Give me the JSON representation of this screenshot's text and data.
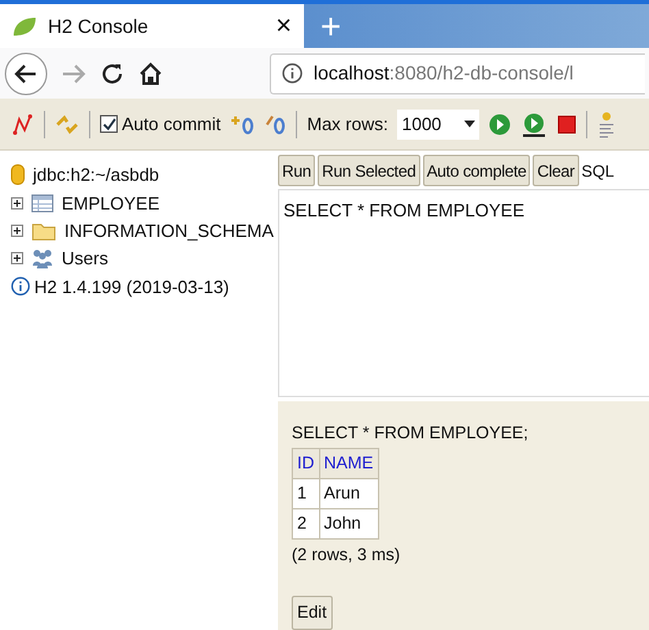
{
  "browser": {
    "tab": {
      "title": "H2 Console",
      "close": "×"
    },
    "new_tab": "+",
    "url": {
      "host": "localhost",
      "rest": ":8080/h2-db-console/l"
    }
  },
  "toolbar": {
    "auto_commit": {
      "label": "Auto commit",
      "checked": true
    },
    "max_rows": {
      "label": "Max rows:",
      "value": "1000"
    }
  },
  "tree": {
    "connection": "jdbc:h2:~/asbdb",
    "items": [
      {
        "kind": "table",
        "label": "EMPLOYEE",
        "expanded": false
      },
      {
        "kind": "folder",
        "label": "INFORMATION_SCHEMA",
        "expanded": false
      },
      {
        "kind": "users",
        "label": "Users",
        "expanded": false
      }
    ],
    "version": "H2 1.4.199 (2019-03-13)"
  },
  "query_buttons": [
    "Run",
    "Run Selected",
    "Auto complete",
    "Clear"
  ],
  "query_label": "SQL",
  "editor": {
    "value": "SELECT * FROM EMPLOYEE"
  },
  "result": {
    "statement": "SELECT * FROM EMPLOYEE;",
    "columns": [
      "ID",
      "NAME"
    ],
    "rows": [
      [
        "1",
        "Arun"
      ],
      [
        "2",
        "John"
      ]
    ],
    "summary": "(2 rows, 3 ms)",
    "edit_button": "Edit"
  }
}
